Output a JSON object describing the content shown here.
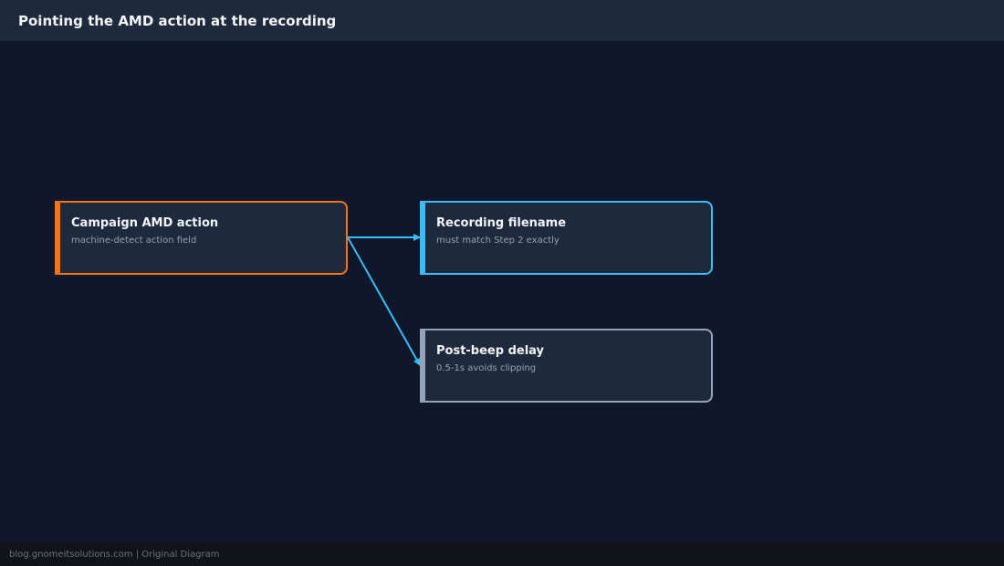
{
  "header": {
    "title": "Pointing the AMD action at the recording"
  },
  "nodes": [
    {
      "id": "campaign-amd-action",
      "title": "Campaign AMD action",
      "subtitle": "machine-detect action field",
      "border_color": "#f97316"
    },
    {
      "id": "recording-filename",
      "title": "Recording filename",
      "subtitle": "must match Step 2 exactly",
      "border_color": "#38bdf8"
    },
    {
      "id": "post-beep-delay",
      "title": "Post-beep delay",
      "subtitle": "0.5-1s avoids clipping",
      "border_color": "#94a3b8"
    }
  ],
  "edges": [
    {
      "from": "campaign-amd-action",
      "to": "recording-filename",
      "color": "#38bdf8"
    },
    {
      "from": "campaign-amd-action",
      "to": "post-beep-delay",
      "color": "#38bdf8"
    }
  ],
  "footer": {
    "text": "blog.gnomeitsolutions.com | Original Diagram"
  },
  "colors": {
    "background": "#0f172a",
    "header_bg": "#1e293b",
    "node_bg": "#1e293b",
    "footer_bg": "#111318",
    "accent": "#38bdf8"
  }
}
